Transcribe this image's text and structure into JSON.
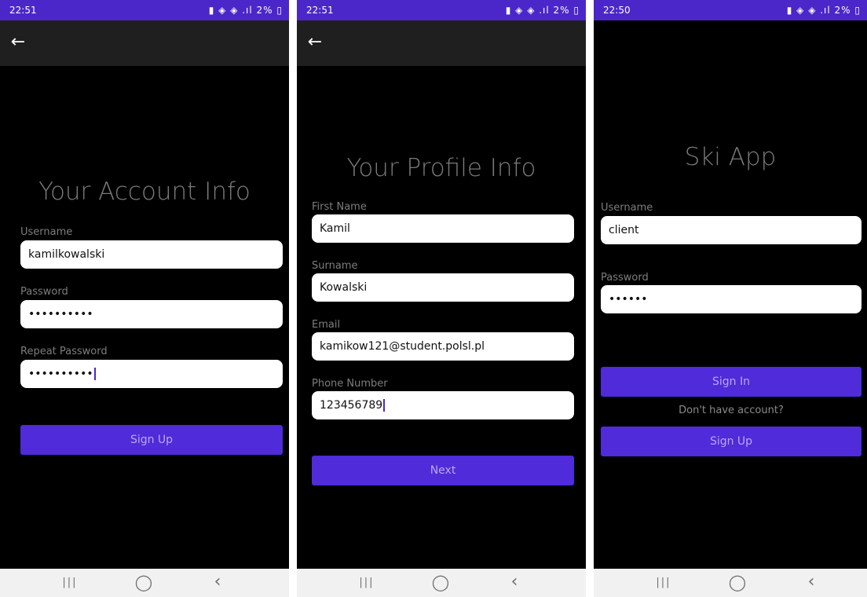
{
  "status_icons": "▮ ◈ ◈ .ıl 2% ▯",
  "icons": {
    "back": "←",
    "recent": "|||",
    "home": "◯",
    "nav_back": "‹"
  },
  "screens": {
    "account": {
      "time": "22:51",
      "title": "Your Account Info",
      "username_label": "Username",
      "username_value": "kamilkowalski",
      "password_label": "Password",
      "password_value": "••••••••••",
      "repeat_label": "Repeat Password",
      "repeat_value": "••••••••••",
      "signup_label": "Sign Up"
    },
    "profile": {
      "time": "22:51",
      "title": "Your Profile Info",
      "first_label": "First Name",
      "first_value": "Kamil",
      "surname_label": "Surname",
      "surname_value": "Kowalski",
      "email_label": "Email",
      "email_value": "kamikow121@student.polsl.pl",
      "phone_label": "Phone Number",
      "phone_value": "123456789",
      "next_label": "Next"
    },
    "login": {
      "time": "22:50",
      "title": "Ski App",
      "username_label": "Username",
      "username_value": "client",
      "password_label": "Password",
      "password_value": "••••••",
      "signin_label": "Sign In",
      "noaccount_text": "Don't have account?",
      "signup_label": "Sign Up"
    }
  },
  "colors": {
    "status_bar": "#4b27c9",
    "primary_button": "#4f2bd9",
    "button_text": "#b9a8f3",
    "title_text": "#7a7a7a"
  }
}
